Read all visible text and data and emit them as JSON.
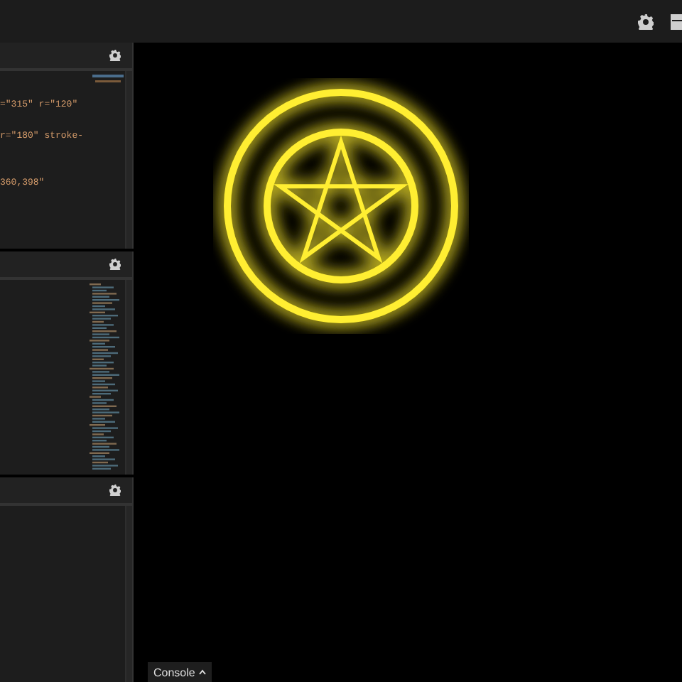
{
  "editor_panels": [
    {
      "kind": "short",
      "lines": [
        "=\"315\" r=\"120\"",
        "r=\"180\" stroke-",
        "360,398\""
      ]
    },
    {
      "kind": "long"
    },
    {
      "kind": "empty"
    }
  ],
  "console_button": {
    "label": "Console"
  }
}
